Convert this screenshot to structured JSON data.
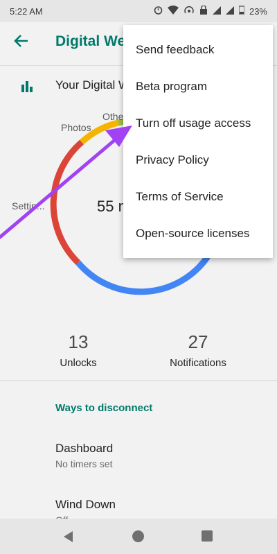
{
  "status": {
    "time": "5:22 AM",
    "battery": "23%"
  },
  "appbar": {
    "title": "Digital We"
  },
  "section": {
    "label": "Your Digital W"
  },
  "chart_data": {
    "type": "pie",
    "labels": [
      "Photos",
      "Othe",
      "Settin..."
    ],
    "center_label": "55 n",
    "colors": {
      "photos": "#f4b400",
      "other": "#a0c040",
      "settings": "#db4437",
      "rest": "#4285f4"
    }
  },
  "stats": {
    "unlocks_value": "13",
    "unlocks_label": "Unlocks",
    "notifications_value": "27",
    "notifications_label": "Notifications"
  },
  "ways": {
    "heading": "Ways to disconnect"
  },
  "list": {
    "dashboard_title": "Dashboard",
    "dashboard_sub": "No timers set",
    "winddown_title": "Wind Down",
    "winddown_sub": "Off"
  },
  "menu": {
    "items": [
      "Send feedback",
      "Beta program",
      "Turn off usage access",
      "Privacy Policy",
      "Terms of Service",
      "Open-source licenses"
    ]
  },
  "colors": {
    "accent": "#00796b",
    "arrow": "#a142f4"
  }
}
